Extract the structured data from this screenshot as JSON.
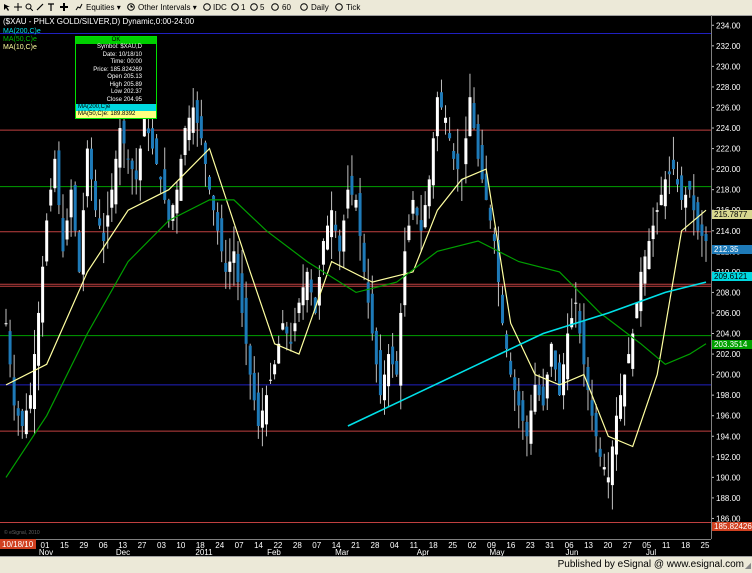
{
  "toolbar": {
    "equities": "Equities",
    "other_intervals": "Other Intervals",
    "intervals": [
      "IDC",
      "1",
      "5",
      "60",
      "Daily",
      "Tick"
    ]
  },
  "chart_title": "($XAU - PHLX GOLD/SILVER,D) Dynamic,0:00-24:00",
  "legend": {
    "ma200": "MA(200,C)e",
    "ma50": "MA(50,C)e",
    "ma10": "MA(10,C)e"
  },
  "popup": {
    "ok": "OK",
    "rows": [
      "Symbol: $XAU,D",
      "Date: 10/18/10",
      "Time: 00:00",
      "Price: 185.824269",
      "Open 205.13",
      "High 205.89",
      "Low 202.37",
      "Close 204.95"
    ],
    "ma200_row": "MA(200,C)e",
    "ma50_row": "MA(50,C)e: 189.8392"
  },
  "price_labels": {
    "ma10": "215.7877",
    "last": "212.35",
    "ma200": "209.6121",
    "ma50": "203.3514",
    "cursor": "185.824269",
    "date_cursor": "10/18/10"
  },
  "colors": {
    "candle": "#1e7ab8",
    "ma200": "#00e0e8",
    "ma50": "#00a000",
    "ma10": "#ffffa0",
    "trendline": "#2020c0"
  },
  "status": "Published by eSignal @ www.esignal.com",
  "watermark": "© eSignal, 2010",
  "chart_data": {
    "type": "candlestick",
    "ylim": [
      184,
      235
    ],
    "y_ticks": [
      186,
      188,
      190,
      192,
      194,
      196,
      198,
      200,
      202,
      204,
      206,
      208,
      210,
      212,
      214,
      216,
      218,
      220,
      222,
      224,
      226,
      228,
      230,
      232,
      234
    ],
    "x_ticks": [
      "01",
      "15",
      "29",
      "06",
      "13",
      "27",
      "03",
      "10",
      "18",
      "24",
      "07",
      "14",
      "22",
      "28",
      "07",
      "14",
      "21",
      "28",
      "04",
      "11",
      "18",
      "25",
      "02",
      "09",
      "16",
      "23",
      "31",
      "06",
      "13",
      "20",
      "27",
      "05",
      "11",
      "18",
      "25"
    ],
    "months": [
      "Nov",
      "Dec",
      "2011",
      "Feb",
      "Mar",
      "Apr",
      "May",
      "Jun",
      "Jul"
    ],
    "horizontal_lines": [
      {
        "value": 233.2,
        "color": "#2020c0"
      },
      {
        "value": 223.8,
        "color": "#c04040"
      },
      {
        "value": 218.3,
        "color": "#00a000"
      },
      {
        "value": 213.9,
        "color": "#c04040"
      },
      {
        "value": 208.8,
        "color": "#c04040"
      },
      {
        "value": 208.6,
        "color": "#c04040"
      },
      {
        "value": 203.8,
        "color": "#00a000"
      },
      {
        "value": 199.0,
        "color": "#2020c0"
      },
      {
        "value": 194.5,
        "color": "#c04040"
      },
      {
        "value": 185.6,
        "color": "#c04040"
      }
    ],
    "closes": [
      [
        0,
        205
      ],
      [
        2,
        197
      ],
      [
        4,
        195
      ],
      [
        6,
        198
      ],
      [
        8,
        206
      ],
      [
        10,
        215
      ],
      [
        12,
        221
      ],
      [
        14,
        212
      ],
      [
        16,
        218
      ],
      [
        18,
        210
      ],
      [
        20,
        222
      ],
      [
        22,
        216
      ],
      [
        24,
        213
      ],
      [
        26,
        218
      ],
      [
        28,
        224
      ],
      [
        30,
        221
      ],
      [
        32,
        219
      ],
      [
        34,
        225
      ],
      [
        36,
        222
      ],
      [
        38,
        219
      ],
      [
        40,
        215
      ],
      [
        42,
        218
      ],
      [
        44,
        224
      ],
      [
        46,
        226
      ],
      [
        48,
        223
      ],
      [
        50,
        218
      ],
      [
        52,
        214
      ],
      [
        54,
        210
      ],
      [
        56,
        212
      ],
      [
        58,
        206
      ],
      [
        60,
        200
      ],
      [
        62,
        195
      ],
      [
        64,
        198
      ],
      [
        66,
        201
      ],
      [
        68,
        205
      ],
      [
        70,
        203
      ],
      [
        72,
        207
      ],
      [
        74,
        210
      ],
      [
        76,
        206
      ],
      [
        78,
        213
      ],
      [
        80,
        216
      ],
      [
        82,
        212
      ],
      [
        84,
        218
      ],
      [
        86,
        217
      ],
      [
        88,
        210
      ],
      [
        90,
        204
      ],
      [
        92,
        198
      ],
      [
        94,
        202
      ],
      [
        96,
        200
      ],
      [
        98,
        212
      ],
      [
        100,
        217
      ],
      [
        102,
        214
      ],
      [
        104,
        219
      ],
      [
        106,
        227
      ],
      [
        108,
        225
      ],
      [
        110,
        221
      ],
      [
        112,
        219
      ],
      [
        114,
        227
      ],
      [
        116,
        221
      ],
      [
        118,
        217
      ],
      [
        120,
        213
      ],
      [
        122,
        205
      ],
      [
        124,
        200
      ],
      [
        126,
        197
      ],
      [
        128,
        194
      ],
      [
        130,
        199
      ],
      [
        132,
        197
      ],
      [
        134,
        203
      ],
      [
        136,
        198
      ],
      [
        138,
        204
      ],
      [
        140,
        207
      ],
      [
        142,
        201
      ],
      [
        144,
        196
      ],
      [
        146,
        192
      ],
      [
        148,
        190
      ],
      [
        150,
        196
      ],
      [
        152,
        200
      ],
      [
        154,
        204
      ],
      [
        156,
        210
      ],
      [
        158,
        213
      ],
      [
        160,
        216
      ],
      [
        162,
        219
      ],
      [
        164,
        220
      ],
      [
        166,
        217
      ],
      [
        168,
        218
      ],
      [
        170,
        214
      ],
      [
        172,
        213
      ]
    ],
    "ma10": [
      [
        0,
        199
      ],
      [
        10,
        201
      ],
      [
        20,
        210
      ],
      [
        30,
        216
      ],
      [
        40,
        218
      ],
      [
        50,
        222
      ],
      [
        60,
        210
      ],
      [
        66,
        203
      ],
      [
        72,
        202
      ],
      [
        80,
        211
      ],
      [
        90,
        209
      ],
      [
        100,
        210
      ],
      [
        106,
        216
      ],
      [
        112,
        219
      ],
      [
        118,
        220
      ],
      [
        124,
        205
      ],
      [
        130,
        200
      ],
      [
        136,
        199
      ],
      [
        142,
        200
      ],
      [
        148,
        194
      ],
      [
        154,
        193
      ],
      [
        160,
        200
      ],
      [
        166,
        214
      ],
      [
        172,
        216
      ]
    ],
    "ma50": [
      [
        0,
        190
      ],
      [
        10,
        196
      ],
      [
        20,
        204
      ],
      [
        30,
        211
      ],
      [
        40,
        215
      ],
      [
        50,
        217
      ],
      [
        56,
        217
      ],
      [
        64,
        214
      ],
      [
        74,
        211
      ],
      [
        86,
        208
      ],
      [
        96,
        209
      ],
      [
        106,
        212
      ],
      [
        116,
        213
      ],
      [
        126,
        211
      ],
      [
        136,
        210
      ],
      [
        146,
        206
      ],
      [
        156,
        203
      ],
      [
        162,
        201
      ],
      [
        168,
        202
      ],
      [
        172,
        203
      ]
    ],
    "ma200": [
      [
        84,
        195
      ],
      [
        100,
        198
      ],
      [
        116,
        201
      ],
      [
        132,
        204
      ],
      [
        148,
        206
      ],
      [
        162,
        208
      ],
      [
        172,
        209
      ]
    ]
  }
}
